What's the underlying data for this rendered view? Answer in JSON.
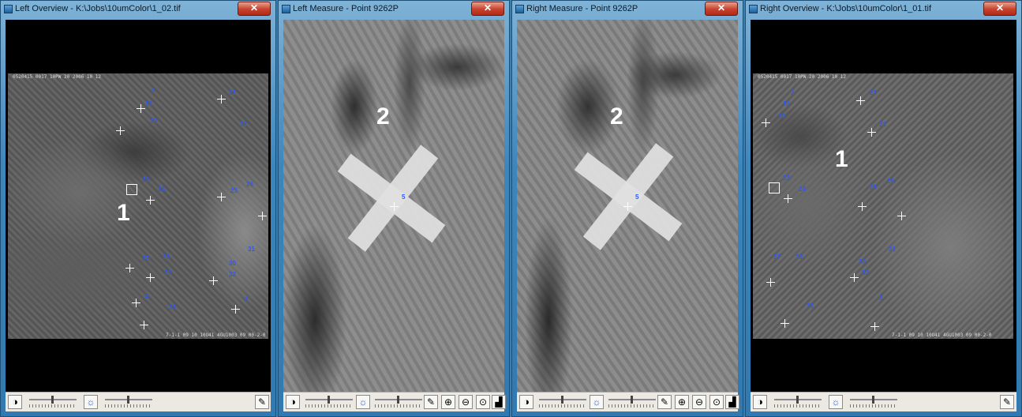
{
  "windows": [
    {
      "title": "Left Overview - K:\\Jobs\\10umColor\\1_02.tif",
      "close": "✕"
    },
    {
      "title": "Left Measure - Point 9262P",
      "close": "✕"
    },
    {
      "title": "Right Measure - Point 9262P",
      "close": "✕"
    },
    {
      "title": "Right Overview - K:\\Jobs\\10umColor\\1_01.tif",
      "close": "✕"
    }
  ],
  "left_overview": {
    "big_label": "1",
    "point_labels": [
      "2",
      "12",
      "13",
      "15",
      "20",
      "21",
      "22",
      "23",
      "24",
      "25",
      "26",
      "27",
      "28",
      "29",
      "30",
      "31",
      "32",
      "33",
      "3",
      "4",
      "5",
      "6",
      "7",
      "8",
      "9"
    ],
    "header_text": "0520415 0017 10PW 20 2006 10 12",
    "footer_text": "7-1-1 09 10 10U41 4GU1003 09 00-2-0"
  },
  "left_measure": {
    "big_label": "2",
    "point_label": "5"
  },
  "right_measure": {
    "big_label": "2",
    "point_label": "5"
  },
  "right_overview": {
    "big_label": "1",
    "point_labels": [
      "2",
      "12",
      "13",
      "15",
      "20",
      "21",
      "22",
      "23",
      "24",
      "25",
      "26",
      "27",
      "28",
      "29",
      "30",
      "31",
      "32",
      "33",
      "3",
      "4",
      "5",
      "6",
      "7",
      "8",
      "9"
    ],
    "header_text": "0520415 0017 10PW 20 2006 10 12",
    "footer_text": "7-1-1 09 10 10U41 4GU1003 09 00-2-0"
  },
  "toolbar": {
    "contrast_icon": "◑",
    "brightness_icon": "☼",
    "brush_icon": "✎",
    "zoom_in_icon": "⊕",
    "zoom_out_icon": "⊖",
    "zoom_fit_icon": "⊙",
    "histogram_icon": "▟"
  }
}
